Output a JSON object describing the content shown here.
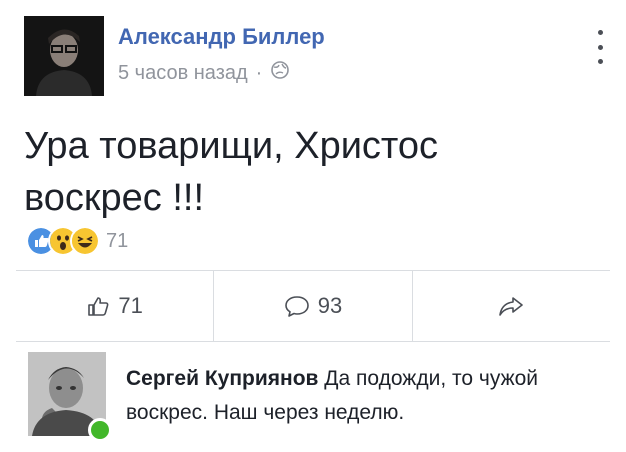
{
  "post": {
    "author": "Александр Биллер",
    "time": "5 часов назад",
    "meta_separator": "·",
    "privacy_icon": "globe-icon",
    "text": "Ура товарищи, Христос воскрес !!!",
    "reactions": {
      "icons": [
        "like-reaction-icon",
        "wow-reaction-icon",
        "haha-reaction-icon"
      ],
      "count": "71"
    }
  },
  "actions": {
    "like_count": "71",
    "comment_count": "93",
    "share_icon": "share-icon"
  },
  "comment": {
    "author": "Сергей Куприянов",
    "text": "Да подожди, то чужой воскрес. Наш через неделю."
  },
  "colors": {
    "author_link": "#4267b2",
    "meta_gray": "#90949c",
    "online_green": "#42b72a",
    "like_blue": "#4a90e2",
    "emoji_yellow": "#f7c531"
  }
}
